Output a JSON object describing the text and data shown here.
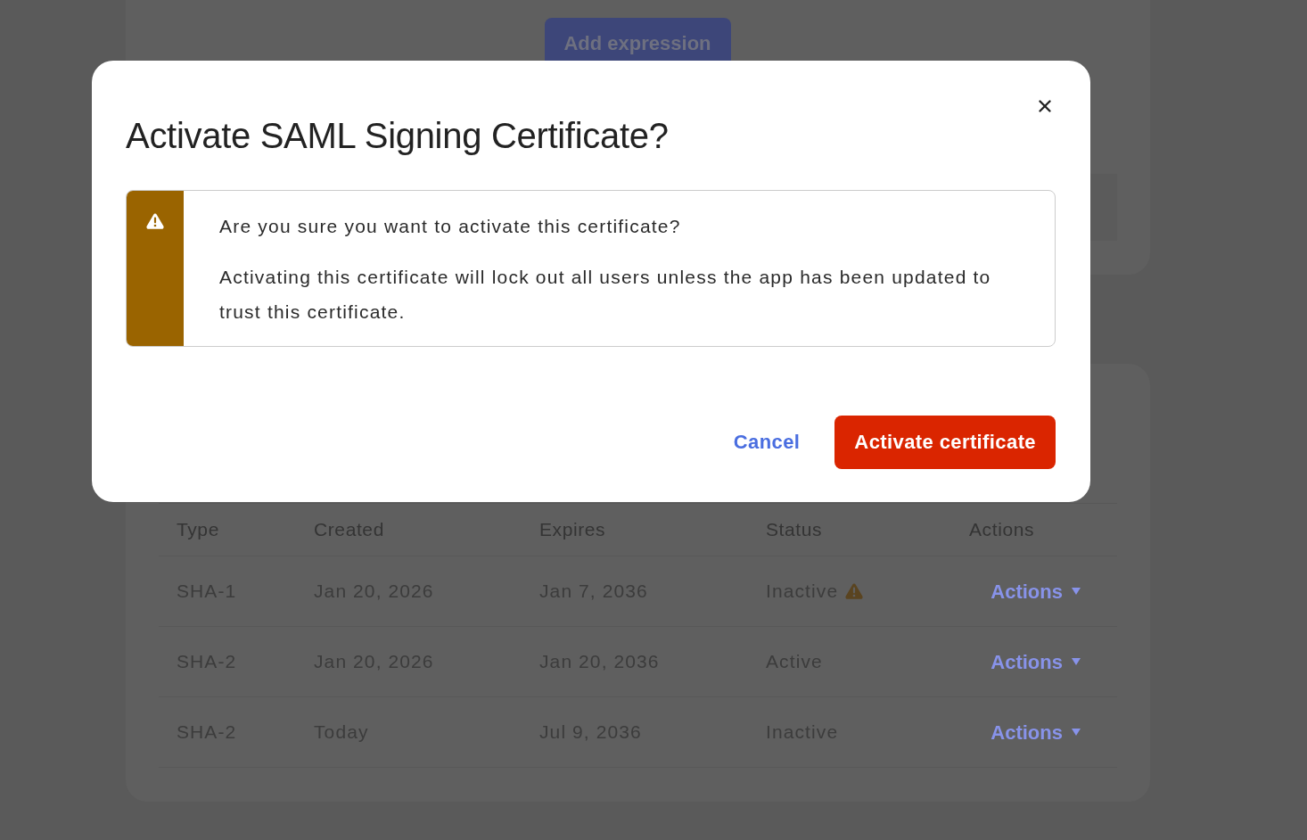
{
  "page": {
    "add_button": {
      "label": "Add expression",
      "disabled": true
    }
  },
  "table": {
    "columns": [
      "Type",
      "Created",
      "Expires",
      "Status",
      "Actions"
    ],
    "rows": [
      {
        "type": "SHA-1",
        "created": "Jan 20, 2026",
        "expires": "Jan 7, 2036",
        "status": "Inactive",
        "warning": true,
        "action": "Actions"
      },
      {
        "type": "SHA-2",
        "created": "Jan 20, 2026",
        "expires": "Jan 20, 2036",
        "status": "Active",
        "warning": false,
        "action": "Actions"
      },
      {
        "type": "SHA-2",
        "created": "Today",
        "expires": "Jul 9, 2036",
        "status": "Inactive",
        "warning": false,
        "action": "Actions"
      }
    ]
  },
  "dialog": {
    "title": "Activate SAML Signing Certificate?",
    "callout": {
      "kind": "warning",
      "heading": "Are you sure you want to activate this certificate?",
      "body": "Activating this certificate will lock out all users unless the app has been updated to trust this certificate."
    },
    "buttons": [
      {
        "label": "Cancel",
        "kind": "link"
      },
      {
        "label": "Activate certificate",
        "kind": "danger"
      }
    ]
  }
}
